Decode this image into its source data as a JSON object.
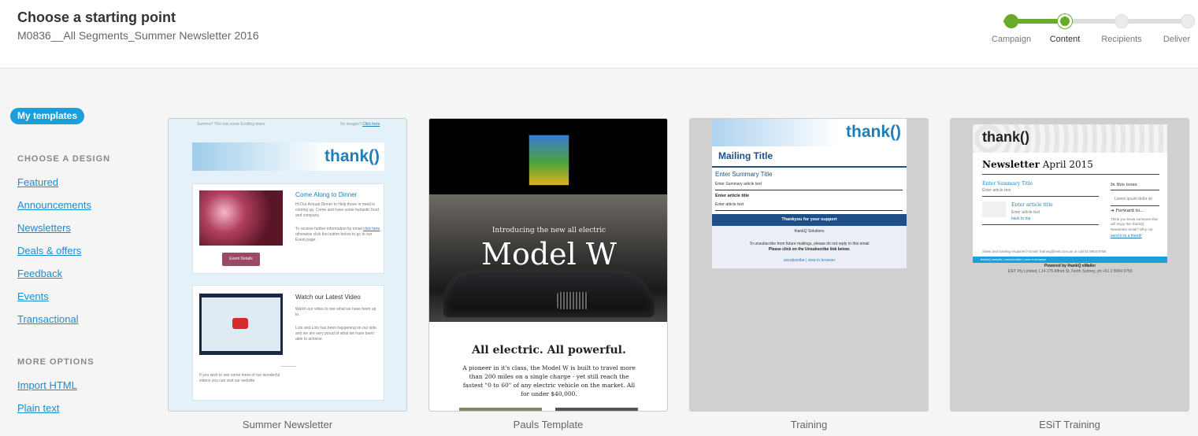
{
  "header": {
    "title": "Choose a starting point",
    "subtitle": "M0836__All Segments_Summer Newsletter 2016"
  },
  "progress": {
    "steps": [
      "Campaign",
      "Content",
      "Recipients",
      "Deliver"
    ],
    "current_step": 2,
    "accent_color": "#6aaa2a"
  },
  "sidebar": {
    "pill_label": "My templates",
    "choose_heading": "CHOOSE A DESIGN",
    "designs": [
      "Featured",
      "Announcements",
      "Newsletters",
      "Deals & offers",
      "Feedback",
      "Events",
      "Transactional"
    ],
    "more_heading": "MORE OPTIONS",
    "options": [
      "Import HTML",
      "Plain text"
    ]
  },
  "templates": [
    {
      "name": "Summer Newsletter",
      "preview": {
        "top_left": "Summer! This has some Exciting times",
        "top_right_prefix": "No images?",
        "top_right_link": "Click here",
        "logo": "thank()",
        "article1_title": "Come Along to Dinner",
        "article1_body": "Hi Our Annual Dinner to Help those in need is coming up. Come and have some fantastic food and company.",
        "article1_body2_prefix": "To receive further information by email",
        "article1_link": "click here",
        "article1_body2_suffix": "otherwise click the button below to go to our Event page.",
        "article1_button": "Event Details",
        "article2_title": "Watch our Latest Video",
        "article2_body": "Watch our video to see what we have been up to.",
        "article2_body2": "Lots and Lots has been happening on our side and we are very proud of what we have been able to achieve.",
        "footer_text": "If you wish to see some more of our wonderful videos you can visit our website"
      }
    },
    {
      "name": "Pauls Template",
      "preview": {
        "intro": "Introducing the new all electric",
        "model": "Model W",
        "headline": "All electric. All powerful.",
        "body": "A pioneer in it's class, the Model W is built to travel more than 200 miles on a single charge - yet still reach the fastest \"0 to 60\" of any electric vehicle on the market. All for under $40,000."
      }
    },
    {
      "name": "Training",
      "preview": {
        "logo": "thank()",
        "mailing_title": "Mailing Title",
        "summary_title": "Enter Summary Title",
        "summary_text": "Enter Summary article text",
        "article_title": "Enter article title",
        "article_text": "Enter article text",
        "band_text": "Thankyou for your support",
        "org": "thankQ Solutions",
        "unsub_line1": "To unsubscribe from future mailings, please do not reply to this email",
        "unsub_line2": "Please click on the Unsubscribe link below.",
        "links": "unsubscribe | view in browser"
      }
    },
    {
      "name": "ESiT Training",
      "preview": {
        "logo": "thank()",
        "newsletter_word": "Newsletter",
        "date": "April 2015",
        "summary_title": "Enter Summary Title",
        "summary_text": "Enter article text",
        "article_title": "Enter article title",
        "article_text": "Enter article text",
        "article_link": "back to top",
        "in_this_issue": "In this issue",
        "issue_item": "Lorem ipsum dolor sit",
        "forward": "Forward to...",
        "forward_text": "Think you know someone that will enjoy this thankQ Newsletter email? Why not",
        "forward_link": "send it to a friend!",
        "contact": "Sales and training enquiries? Email: training@esit.com.au or call 02 8904 9755",
        "bar_links": "thankQ website | unsubscribe | view in browser",
        "powered": "Powered by thankQ eMailer",
        "address": "ESiT Pty Limited, L14 275 Alfred St, North Sydney, ph +61 2 8904 9750"
      }
    }
  ]
}
